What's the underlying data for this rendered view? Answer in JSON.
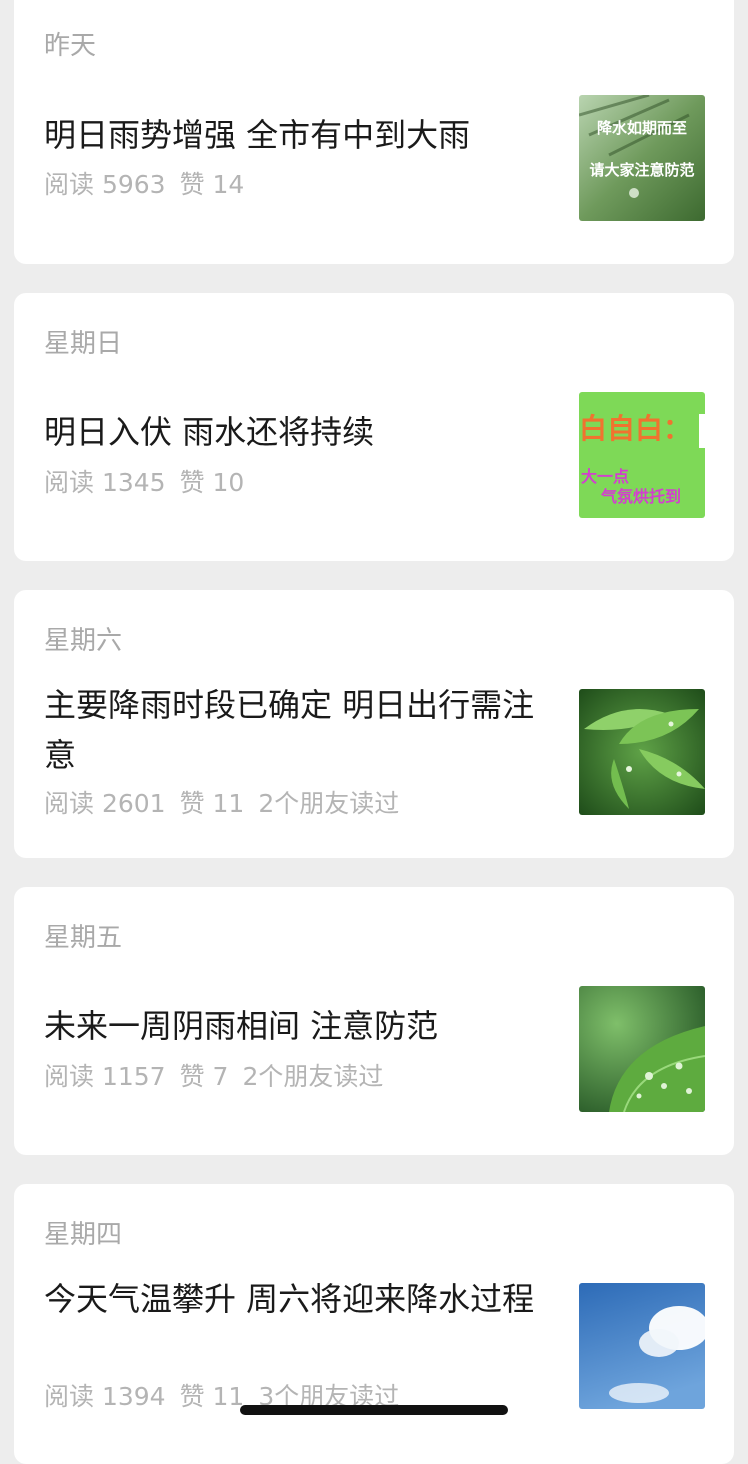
{
  "articles": [
    {
      "date": "昨天",
      "title": "明日雨势增强 全市有中到大雨",
      "reads": "阅读 5963",
      "likes": "赞 14",
      "friends": "",
      "thumb_text": [
        "降水如期而至",
        "请大家注意防范"
      ]
    },
    {
      "date": "星期日",
      "title": "明日入伏  雨水还将持续",
      "reads": "阅读 1345",
      "likes": "赞 10",
      "friends": "",
      "thumb_text": [
        "白自白：",
        "大一点",
        "气氛烘托到"
      ]
    },
    {
      "date": "星期六",
      "title": "主要降雨时段已确定  明日出行需注意",
      "reads": "阅读 2601",
      "likes": "赞 11",
      "friends": "2个朋友读过",
      "thumb_text": []
    },
    {
      "date": "星期五",
      "title": "未来一周阴雨相间 注意防范",
      "reads": "阅读 1157",
      "likes": "赞 7",
      "friends": "2个朋友读过",
      "thumb_text": []
    },
    {
      "date": "星期四",
      "title": "今天气温攀升 周六将迎来降水过程",
      "reads": "阅读 1394",
      "likes": "赞 11",
      "friends": "3个朋友读过",
      "thumb_text": []
    }
  ]
}
